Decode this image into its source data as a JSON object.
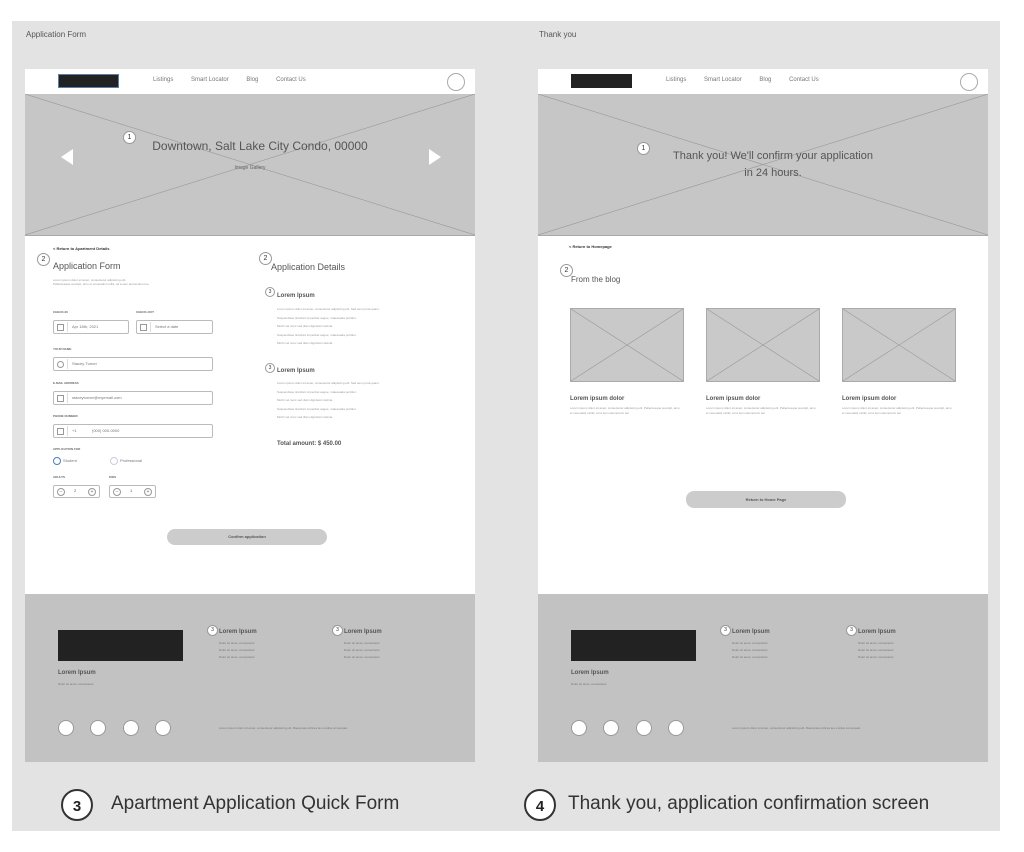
{
  "left_frame": {
    "label": "Application Form",
    "nav": {
      "links": [
        "Listings",
        "Smart Locator",
        "Blog",
        "Contact Us"
      ]
    },
    "hero": {
      "badge": "1",
      "title": "Downtown, Salt Lake City Condo, 00000",
      "subtitle": "Image Gallery"
    },
    "form": {
      "back_link": "< Return to Apartment Details",
      "badge": "2",
      "title": "Application Form",
      "intro_1": "Lorem ipsum dolor sit amet, consectetur adipiscing elit.",
      "intro_2": "Pellentesque suscipit, arcu et venenatis mollis, tel a sem elementum leo.",
      "check_in_label": "CHECK-IN",
      "check_in_value": "Apr 18th, 2021",
      "check_out_label": "CHECK-OUT",
      "check_out_value": "Select a date",
      "name_label": "YOUR NAME",
      "name_value": "Stacey Turner",
      "email_label": "E-MAIL ADDRESS",
      "email_value": "staceyturner@myemail.com",
      "phone_label": "PHONE NUMBER",
      "phone_prefix": "+1",
      "phone_value": "(000) 000-0000",
      "app_type_label": "APPLICATION FOR",
      "option_student": "Student",
      "option_professional": "Professional",
      "adults_label": "ADULTS",
      "adults_value": "2",
      "kids_label": "KIDS",
      "kids_value": "1",
      "confirm_button": "Confirm application"
    },
    "details": {
      "badge": "2",
      "title": "Application Details",
      "block1_badge": "3",
      "block1_title": "Lorem Ipsum",
      "block1_lines": [
        "Lorem ipsum dolor sit amet, consectetur adipiscing elit. Sed sem porta quam.",
        "Suspendisse tincidunt imperdiet augue, malesuada porttitor.",
        "Morbi vel nunc sed diam dignissim lacinia.",
        "Suspendisse tincidunt imperdiet augue, malesuada porttitor.",
        "Morbi vel nunc sed diam dignissim lacinia."
      ],
      "block2_badge": "3",
      "block2_title": "Lorem Ipsum",
      "block2_lines": [
        "Lorem ipsum dolor sit amet, consectetur adipiscing elit. Sed sem porta quam.",
        "Suspendisse tincidunt imperdiet augue, malesuada porttitor.",
        "Morbi vel nunc sed diam dignissim lacinia.",
        "Suspendisse tincidunt imperdiet augue, malesuada porttitor.",
        "Morbi vel nunc sed diam dignissim lacinia."
      ],
      "total": "Total amount: $ 450.00"
    }
  },
  "right_frame": {
    "label": "Thank you",
    "nav": {
      "links": [
        "Listings",
        "Smart Locator",
        "Blog",
        "Contact Us"
      ]
    },
    "hero": {
      "badge": "1",
      "title_line1": "Thank you! We'll confirm your application",
      "title_line2": "in 24 hours."
    },
    "back_link": "< Return to Homepage",
    "blog_badge": "2",
    "blog_title": "From the blog",
    "posts": [
      {
        "title": "Lorem ipsum dolor",
        "text": "Lorem ipsum dolor sit amet, consectetur adipiscing elit. Pellentesque suscipit, arcu et venenatis mollis, tel a sem elementum leo."
      },
      {
        "title": "Lorem ipsum dolor",
        "text": "Lorem ipsum dolor sit amet, consectetur adipiscing elit. Pellentesque suscipit, arcu et venenatis mollis, tel a sem elementum leo."
      },
      {
        "title": "Lorem ipsum dolor",
        "text": "Lorem ipsum dolor sit amet, consectetur adipiscing elit. Pellentesque suscipit, arcu et venenatis mollis, tel a sem elementum leo."
      }
    ],
    "return_button": "Return to Home Page"
  },
  "footer": {
    "brand_title": "Lorem Ipsum",
    "brand_sub": "Dolor sit amet, consectetur",
    "col_badge": "3",
    "col_title": "Lorem Ipsum",
    "col_lines": [
      "Dolor sit amet, consectetur",
      "Dolor sit amet, consectetur",
      "Dolor sit amet, consectetur"
    ],
    "bottom_text": "Lorem ipsum dolor sit amet, consectetur adipiscing elit. Maecenas ultrices leo a tellus consequat."
  },
  "captions": {
    "left_num": "3",
    "left_text": "Apartment Application Quick Form",
    "right_num": "4",
    "right_text": "Thank you, application confirmation screen"
  }
}
